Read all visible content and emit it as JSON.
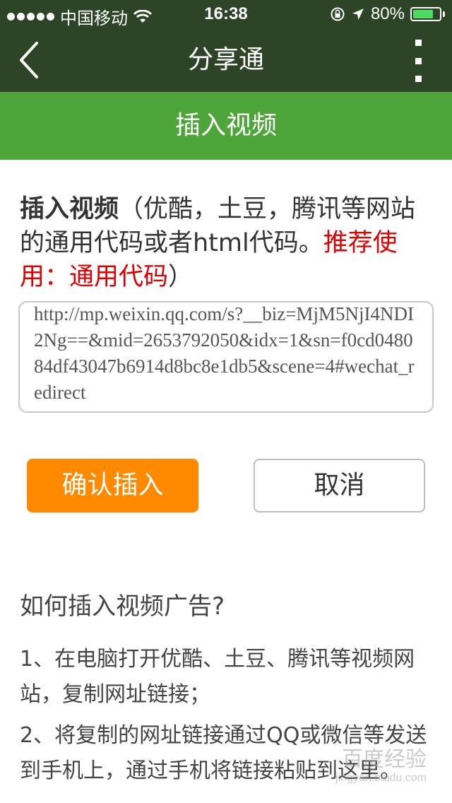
{
  "status_bar": {
    "carrier": "中国移动",
    "time": "16:38",
    "battery": "80%",
    "battery_level": 0.8,
    "icons": [
      "signal-dots-icon",
      "wifi-icon",
      "rotation-lock-icon",
      "location-arrow-icon",
      "battery-icon"
    ]
  },
  "nav": {
    "title": "分享通",
    "icons": [
      "back-chevron-icon",
      "more-vertical-icon"
    ]
  },
  "section": {
    "title": "插入视频"
  },
  "intro": {
    "bold": "插入视频",
    "normal": "（优酷，土豆，腾讯等网站的通用代码或者html代码。",
    "red": "推荐使用：通用代码",
    "close": "）"
  },
  "url_field": {
    "value": "http://mp.weixin.qq.com/s?__biz=MjM5NjI4NDI2Ng==&mid=2653792050&idx=1&sn=f0cd048084df43047b6914d8bc8e1db5&scene=4#wechat_redirect"
  },
  "buttons": {
    "confirm": "确认插入",
    "cancel": "取消"
  },
  "help": {
    "title": "如何插入视频广告?",
    "steps": [
      "1、在电脑打开优酷、土豆、腾讯等视频网站，复制网址链接；",
      "2、将复制的网址链接通过QQ或微信等发送到手机上，通过手机将链接粘贴到这里。"
    ]
  },
  "watermark": {
    "main": "百度经验",
    "sub": "jingyan.baidu.com"
  },
  "colors": {
    "nav_bg": "#2d4427",
    "section_bg": "#4ea63a",
    "confirm_bg": "#ff8a00",
    "accent_red": "#e00000",
    "battery_fill": "#4cd964"
  }
}
